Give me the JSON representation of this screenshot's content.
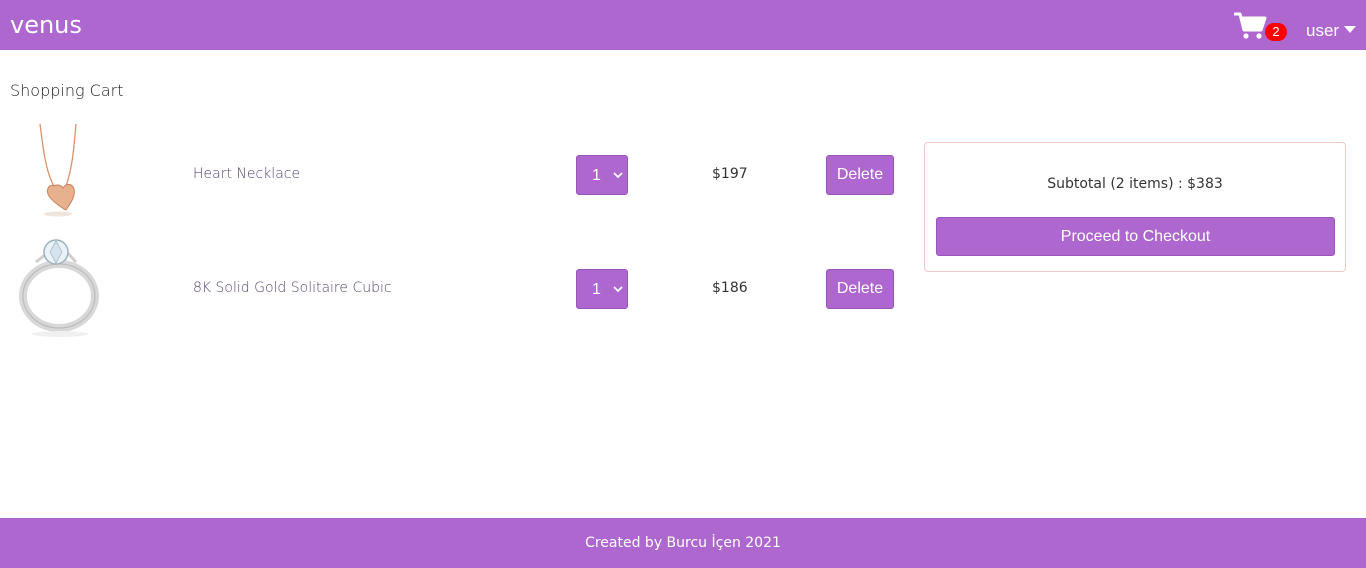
{
  "header": {
    "brand": "venus",
    "cart_count": "2",
    "user_label": "user",
    "background_color": "#ad67cf"
  },
  "cart": {
    "title": "Shopping Cart",
    "items": [
      {
        "name": "Heart Necklace",
        "quantity": "1",
        "price": "$197",
        "delete_label": "Delete",
        "image": "heart-necklace-image"
      },
      {
        "name": "8K Solid Gold Solitaire Cubic",
        "quantity": "1",
        "price": "$186",
        "delete_label": "Delete",
        "image": "solitaire-ring-image"
      }
    ]
  },
  "summary": {
    "subtotal": "Subtotal (2 items) : $383",
    "checkout_label": "Proceed to Checkout"
  },
  "footer": {
    "text": "Created by Burcu İçen 2021"
  },
  "colors": {
    "accent": "#ad67cf",
    "badge": "#ff0000"
  }
}
